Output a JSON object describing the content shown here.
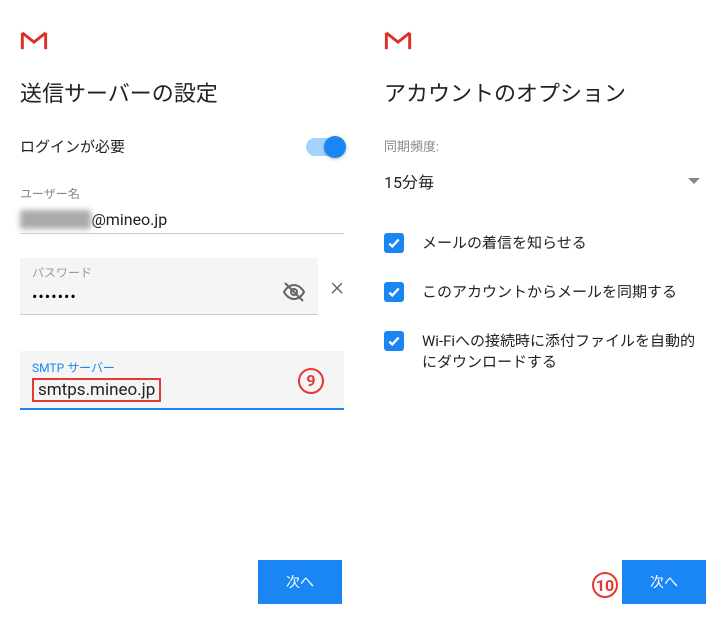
{
  "left": {
    "title": "送信サーバーの設定",
    "loginRequired": "ログインが必要",
    "usernameLabel": "ユーザー名",
    "usernameBlurred": "xxxxxxxxx",
    "usernameDomain": "@mineo.jp",
    "passwordLabel": "パスワード",
    "passwordValue": "•••••••",
    "smtpLabel": "SMTP サーバー",
    "smtpValue": "smtps.mineo.jp",
    "callout": "9",
    "nextBtn": "次へ"
  },
  "right": {
    "title": "アカウントのオプション",
    "syncFreqLabel": "同期頻度:",
    "syncFreqValue": "15分毎",
    "check1": "メールの着信を知らせる",
    "check2": "このアカウントからメールを同期する",
    "check3": "Wi-Fiへの接続時に添付ファイルを自動的にダウンロードする",
    "callout": "10",
    "nextBtn": "次へ"
  }
}
